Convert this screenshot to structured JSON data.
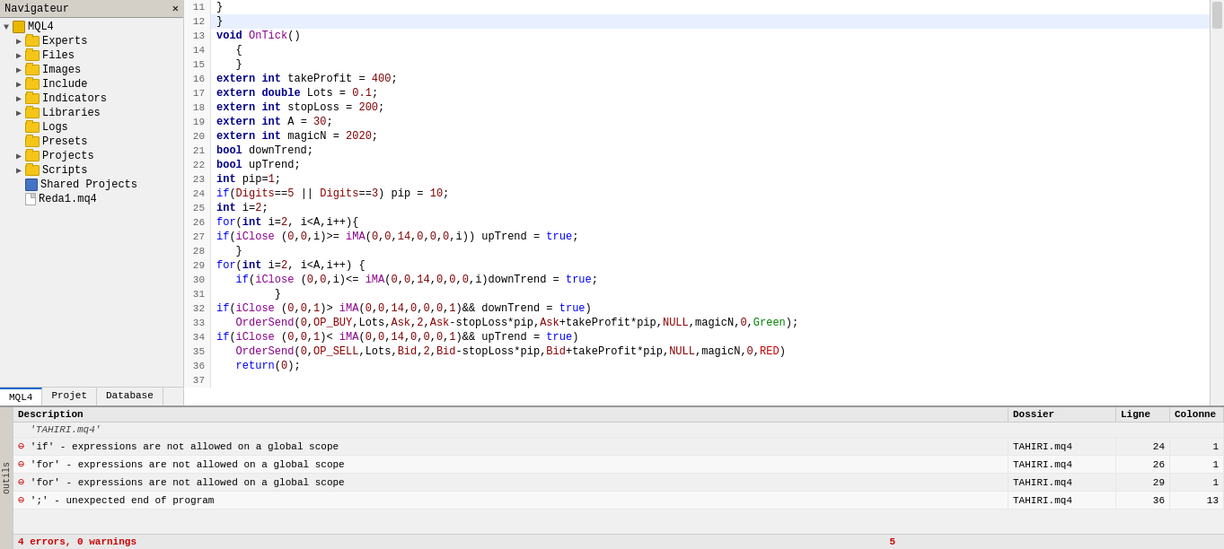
{
  "navigator": {
    "title": "Navigateur",
    "items": [
      {
        "id": "mql4",
        "label": "MQL4",
        "indent": 0,
        "type": "mql4",
        "expanded": true
      },
      {
        "id": "experts",
        "label": "Experts",
        "indent": 1,
        "type": "folder",
        "expanded": false
      },
      {
        "id": "files",
        "label": "Files",
        "indent": 1,
        "type": "folder",
        "expanded": false
      },
      {
        "id": "images",
        "label": "Images",
        "indent": 1,
        "type": "folder",
        "expanded": false
      },
      {
        "id": "include",
        "label": "Include",
        "indent": 1,
        "type": "folder",
        "expanded": false
      },
      {
        "id": "indicators",
        "label": "Indicators",
        "indent": 1,
        "type": "folder",
        "expanded": false
      },
      {
        "id": "libraries",
        "label": "Libraries",
        "indent": 1,
        "type": "folder",
        "expanded": false
      },
      {
        "id": "logs",
        "label": "Logs",
        "indent": 1,
        "type": "folder",
        "expanded": false
      },
      {
        "id": "presets",
        "label": "Presets",
        "indent": 1,
        "type": "folder",
        "expanded": false
      },
      {
        "id": "projects",
        "label": "Projects",
        "indent": 1,
        "type": "folder",
        "expanded": false
      },
      {
        "id": "scripts",
        "label": "Scripts",
        "indent": 1,
        "type": "folder",
        "expanded": false
      },
      {
        "id": "shared-projects",
        "label": "Shared Projects",
        "indent": 1,
        "type": "shared",
        "expanded": false
      },
      {
        "id": "reda1",
        "label": "Reda1.mq4",
        "indent": 1,
        "type": "file",
        "expanded": false
      }
    ],
    "tabs": [
      {
        "id": "mql4",
        "label": "MQL4",
        "active": true
      },
      {
        "id": "projet",
        "label": "Projet",
        "active": false
      },
      {
        "id": "database",
        "label": "Database",
        "active": false
      }
    ]
  },
  "code": {
    "lines": [
      {
        "num": 11,
        "content": "}",
        "tokens": [
          {
            "text": "}",
            "class": "op"
          }
        ]
      },
      {
        "num": 12,
        "content": "}",
        "tokens": [
          {
            "text": "}",
            "class": "op"
          }
        ],
        "highlighted": true
      },
      {
        "num": 13,
        "content": "void OnTick()",
        "raw": true
      },
      {
        "num": 14,
        "content": "   {",
        "raw": true
      },
      {
        "num": 15,
        "content": "   }",
        "raw": true
      },
      {
        "num": 16,
        "content": "extern int takeProfit = 400;",
        "raw": true
      },
      {
        "num": 17,
        "content": "extern double Lots = 0.1;",
        "raw": true
      },
      {
        "num": 18,
        "content": "extern int stopLoss = 200;",
        "raw": true
      },
      {
        "num": 19,
        "content": "extern int A = 30;",
        "raw": true
      },
      {
        "num": 20,
        "content": "extern int magicN = 2020;",
        "raw": true
      },
      {
        "num": 21,
        "content": "bool downTrend;",
        "raw": true
      },
      {
        "num": 22,
        "content": "bool upTrend;",
        "raw": true
      },
      {
        "num": 23,
        "content": "int pip=1;",
        "raw": true
      },
      {
        "num": 24,
        "content": "if(Digits==5 || Digits==3) pip = 10;",
        "raw": true
      },
      {
        "num": 25,
        "content": "int i=2;",
        "raw": true
      },
      {
        "num": 26,
        "content": "for(int i=2, i<A,i++){",
        "raw": true
      },
      {
        "num": 27,
        "content": "if(iClose (0,0,i)>= iMA(0,0,14,0,0,0,i)) upTrend = true;",
        "raw": true
      },
      {
        "num": 28,
        "content": "   }",
        "raw": true
      },
      {
        "num": 29,
        "content": "for(int i=2, i<A,i++) {",
        "raw": true
      },
      {
        "num": 30,
        "content": "   if(iClose (0,0,i)<= iMA(0,0,14,0,0,0,i)downTrend = true;",
        "raw": true
      },
      {
        "num": 31,
        "content": "         }",
        "raw": true
      },
      {
        "num": 32,
        "content": "if(iClose (0,0,1)> iMA(0,0,14,0,0,0,1)&& downTrend = true)",
        "raw": true
      },
      {
        "num": 33,
        "content": "   OrderSend(0,OP_BUY,Lots,Ask,2,Ask-stopLoss*pip,Ask+takeProfit*pip,NULL,magicN,0,Green);",
        "raw": true
      },
      {
        "num": 34,
        "content": "if(iClose (0,0,1)< iMA(0,0,14,0,0,0,1)&& upTrend = true)",
        "raw": true
      },
      {
        "num": 35,
        "content": "   OrderSend(0,OP_SELL,Lots,Bid,2,Bid-stopLoss*pip,Bid+takeProfit*pip,NULL,magicN,0,RED)",
        "raw": true
      },
      {
        "num": 36,
        "content": "   return(0);",
        "raw": true
      },
      {
        "num": 37,
        "content": "",
        "raw": true
      }
    ]
  },
  "errors": {
    "columns": {
      "description": "Description",
      "dossier": "Dossier",
      "ligne": "Ligne",
      "colonne": "Colonne"
    },
    "rows": [
      {
        "type": "section",
        "description": "'TAHIRI.mq4'",
        "dossier": "",
        "ligne": "",
        "colonne": ""
      },
      {
        "type": "error",
        "description": "'if' - expressions are not allowed on a global scope",
        "dossier": "TAHIRI.mq4",
        "ligne": "24",
        "colonne": "1"
      },
      {
        "type": "error",
        "description": "'for' - expressions are not allowed on a global scope",
        "dossier": "TAHIRI.mq4",
        "ligne": "26",
        "colonne": "1"
      },
      {
        "type": "error",
        "description": "'for' - expressions are not allowed on a global scope",
        "dossier": "TAHIRI.mq4",
        "ligne": "29",
        "colonne": "1"
      },
      {
        "type": "error",
        "description": "';' - unexpected end of program",
        "dossier": "TAHIRI.mq4",
        "ligne": "36",
        "colonne": "13"
      }
    ],
    "footer": "4 errors, 0 warnings",
    "error_count_text": "4 errors, 0 warnings",
    "total_errors": "5"
  }
}
